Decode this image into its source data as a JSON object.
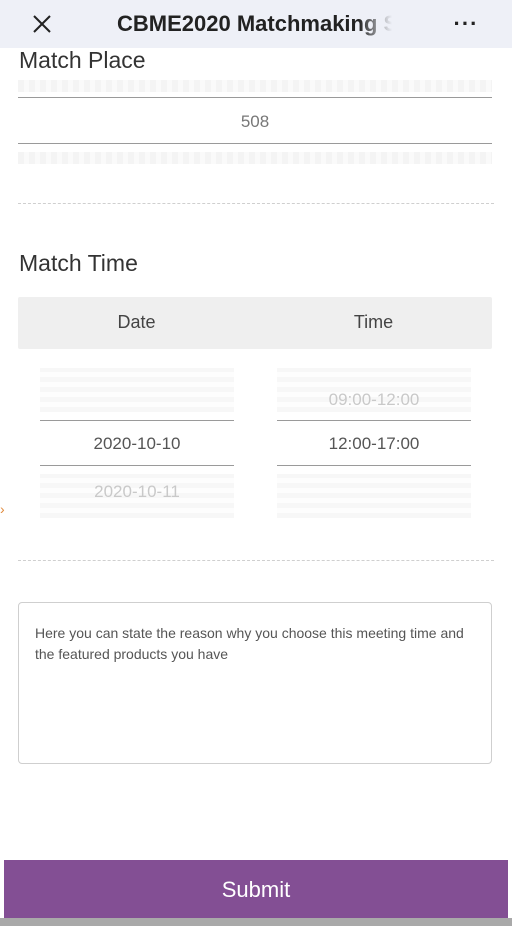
{
  "header": {
    "title": "CBME2020 Matchmaking S",
    "more_label": "···"
  },
  "match_place": {
    "label": "Match Place",
    "value": "508"
  },
  "match_time": {
    "label": "Match Time",
    "columns": [
      "Date",
      "Time"
    ],
    "date_options": {
      "selected": "2020-10-10",
      "next": "2020-10-11"
    },
    "time_options": {
      "previous": "09:00-12:00",
      "selected": "12:00-17:00"
    }
  },
  "reason": {
    "placeholder": "Here you can state the reason why you choose this meeting time and the featured products you have"
  },
  "footer": {
    "submit_label": "Submit"
  },
  "colors": {
    "submit_bg": "#834f94",
    "header_bg": "#eef0f7"
  }
}
